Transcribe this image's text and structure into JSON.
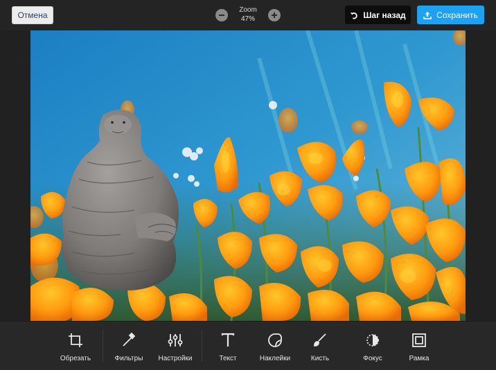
{
  "header": {
    "cancel_label": "Отмена",
    "zoom_label": "Zoom",
    "zoom_value": "47%",
    "undo_label": "Шаг назад",
    "save_label": "Сохранить"
  },
  "canvas": {
    "image_content": "Photo of orange poppy flowers under blue sky with a grey wrinkled creature sticker"
  },
  "toolbar": {
    "tools": [
      {
        "label": "Обрезать",
        "icon": "crop-icon"
      },
      {
        "label": "Фильтры",
        "icon": "magic-wand-icon"
      },
      {
        "label": "Настройки",
        "icon": "sliders-icon"
      },
      {
        "label": "Текст",
        "icon": "text-icon"
      },
      {
        "label": "Наклейки",
        "icon": "sticker-icon"
      },
      {
        "label": "Кисть",
        "icon": "brush-icon"
      },
      {
        "label": "Фокус",
        "icon": "focus-icon"
      },
      {
        "label": "Рамка",
        "icon": "frame-icon"
      }
    ]
  },
  "colors": {
    "accent": "#1da1f2",
    "toolbar_bg": "#282828",
    "undo_bg": "#0d0d0d"
  }
}
